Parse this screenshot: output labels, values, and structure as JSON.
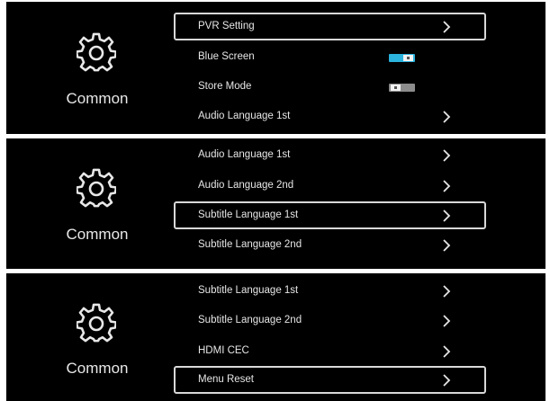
{
  "colors": {
    "panel_bg": "#000000",
    "text": "#e6e6e6",
    "highlight_border": "#d8d8d8",
    "toggle_on": "#2bb3dd",
    "toggle_off": "#8c8c8c"
  },
  "panels": [
    {
      "category": {
        "icon": "gear-icon",
        "label": "Common"
      },
      "items": [
        {
          "label": "PVR Setting",
          "type": "submenu",
          "selected": true
        },
        {
          "label": "Blue Screen",
          "type": "toggle",
          "value": "on"
        },
        {
          "label": "Store Mode",
          "type": "toggle",
          "value": "off"
        },
        {
          "label": "Audio Language 1st",
          "type": "submenu",
          "selected": false
        }
      ]
    },
    {
      "category": {
        "icon": "gear-icon",
        "label": "Common"
      },
      "items": [
        {
          "label": "Audio Language 1st",
          "type": "submenu",
          "selected": false
        },
        {
          "label": "Audio Language 2nd",
          "type": "submenu",
          "selected": false
        },
        {
          "label": "Subtitle Language 1st",
          "type": "submenu",
          "selected": true
        },
        {
          "label": "Subtitle Language 2nd",
          "type": "submenu",
          "selected": false
        }
      ]
    },
    {
      "category": {
        "icon": "gear-icon",
        "label": "Common"
      },
      "items": [
        {
          "label": "Subtitle Language 1st",
          "type": "submenu",
          "selected": false
        },
        {
          "label": "Subtitle Language 2nd",
          "type": "submenu",
          "selected": false
        },
        {
          "label": "HDMI CEC",
          "type": "submenu",
          "selected": false
        },
        {
          "label": "Menu Reset",
          "type": "submenu",
          "selected": true
        }
      ]
    }
  ]
}
